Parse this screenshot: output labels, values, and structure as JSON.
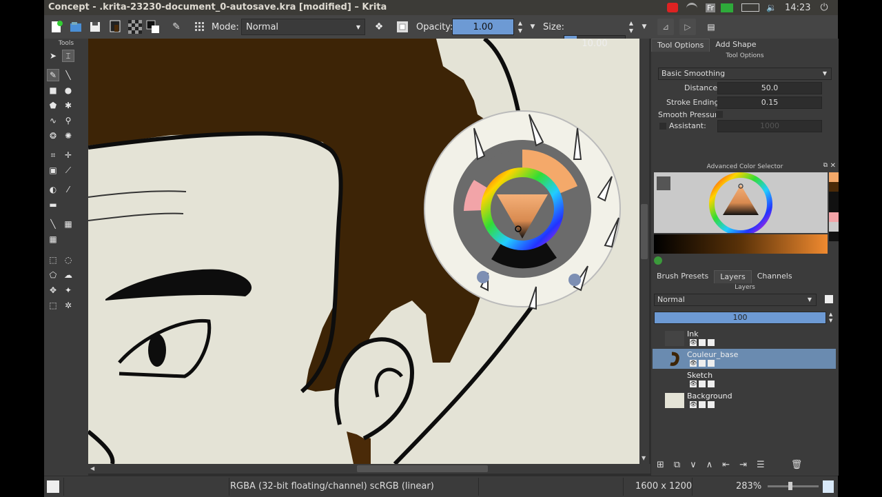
{
  "window": {
    "title": "Concept - .krita-23230-document_0-autosave.kra [modified] – Krita"
  },
  "tray": {
    "keyboard": "Fr",
    "clock": "14:23"
  },
  "toolbar": {
    "mode_label": "Mode:",
    "mode_value": "Normal",
    "opacity_label": "Opacity:",
    "opacity_value": "1.00",
    "opacity_fraction": 1.0,
    "size_label": "Size:",
    "size_value": "10.00"
  },
  "toolbox": {
    "title": "Tools"
  },
  "tool_options": {
    "tabs": [
      "Tool Options",
      "Add Shape"
    ],
    "title": "Tool Options",
    "smoothing": "Basic Smoothing",
    "distance_label": "Distance:",
    "distance_value": "50.0",
    "stroke_ending_label": "Stroke Ending:",
    "stroke_ending_value": "0.15",
    "smooth_pressure_label": "Smooth Pressure",
    "assistant_label": "Assistant:",
    "assistant_value": "1000"
  },
  "color_selector": {
    "title": "Advanced Color Selector"
  },
  "layers_docker": {
    "tabs": [
      "Brush Presets",
      "Layers",
      "Channels"
    ],
    "title": "Layers",
    "blend_mode": "Normal",
    "opacity_value": "100",
    "layers": [
      {
        "name": "Ink",
        "selected": false
      },
      {
        "name": "Couleur_base",
        "selected": true
      },
      {
        "name": "Sketch",
        "selected": false
      },
      {
        "name": "Background",
        "selected": false
      }
    ]
  },
  "status": {
    "colorspace": "RGBA (32-bit floating/channel)  scRGB (linear)",
    "dimensions": "1600 x 1200",
    "zoom": "283%"
  },
  "colors": {
    "accent": "#6d9ad4",
    "hair": "#3d2406",
    "skin": "#e4e3d6",
    "selection": "#6a8bb0"
  }
}
